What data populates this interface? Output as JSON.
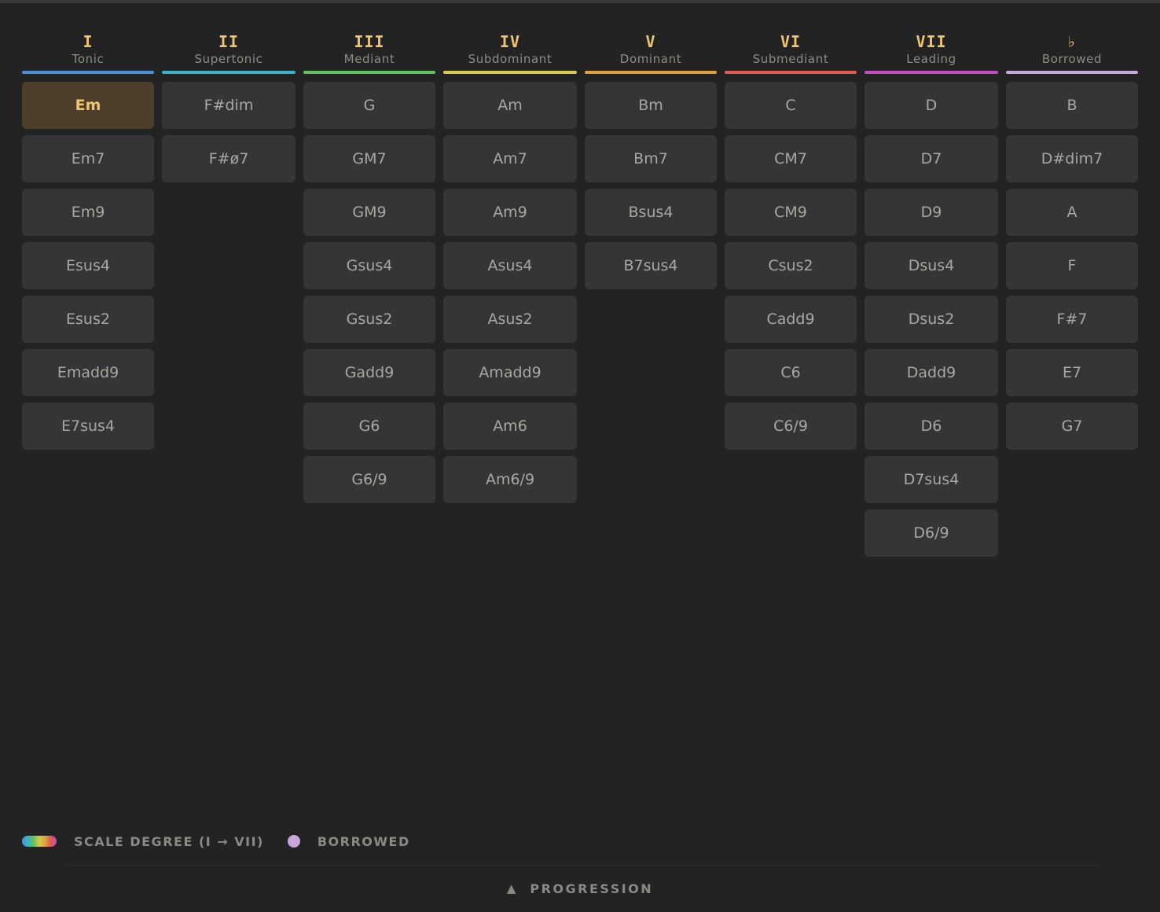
{
  "accent": "#f2c46d",
  "columns": [
    {
      "numeral": "I",
      "name": "Tonic",
      "color": "#4a8fd8",
      "chords": [
        "Em",
        "Em7",
        "Em9",
        "Esus4",
        "Esus2",
        "Emadd9",
        "E7sus4"
      ]
    },
    {
      "numeral": "II",
      "name": "Supertonic",
      "color": "#3bb3c8",
      "chords": [
        "F#dim",
        "F#ø7"
      ]
    },
    {
      "numeral": "III",
      "name": "Mediant",
      "color": "#5fc25f",
      "chords": [
        "G",
        "GM7",
        "GM9",
        "Gsus4",
        "Gsus2",
        "Gadd9",
        "G6",
        "G6/9"
      ]
    },
    {
      "numeral": "IV",
      "name": "Subdominant",
      "color": "#d8c948",
      "chords": [
        "Am",
        "Am7",
        "Am9",
        "Asus4",
        "Asus2",
        "Amadd9",
        "Am6",
        "Am6/9"
      ]
    },
    {
      "numeral": "V",
      "name": "Dominant",
      "color": "#e0a03c",
      "chords": [
        "Bm",
        "Bm7",
        "Bsus4",
        "B7sus4"
      ]
    },
    {
      "numeral": "VI",
      "name": "Submediant",
      "color": "#e05a4e",
      "chords": [
        "C",
        "CM7",
        "CM9",
        "Csus2",
        "Cadd9",
        "C6",
        "C6/9"
      ]
    },
    {
      "numeral": "VII",
      "name": "Leading",
      "color": "#c44cbf",
      "chords": [
        "D",
        "D7",
        "D9",
        "Dsus4",
        "Dsus2",
        "Dadd9",
        "D6",
        "D7sus4",
        "D6/9"
      ]
    },
    {
      "numeral": "♭",
      "name": "Borrowed",
      "color": "#c7a7d9",
      "chords": [
        "B",
        "D#dim7",
        "A",
        "F",
        "F#7",
        "E7",
        "G7"
      ]
    }
  ],
  "selected_chord": "Em",
  "legend": {
    "scale_degree_label": "SCALE DEGREE (I → VII)",
    "borrowed_label": "BORROWED",
    "borrowed_color": "#c7a7d9"
  },
  "progression": {
    "icon": "triangle-up-icon",
    "label": "PROGRESSION"
  }
}
